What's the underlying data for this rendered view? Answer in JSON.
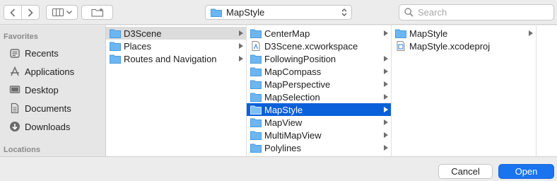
{
  "toolbar": {
    "path_label": "MapStyle",
    "search_placeholder": "Search"
  },
  "sidebar": {
    "favorites_header": "Favorites",
    "locations_header": "Locations",
    "items": [
      {
        "label": "Recents",
        "icon": "recents-icon"
      },
      {
        "label": "Applications",
        "icon": "applications-icon"
      },
      {
        "label": "Desktop",
        "icon": "desktop-icon"
      },
      {
        "label": "Documents",
        "icon": "documents-icon"
      },
      {
        "label": "Downloads",
        "icon": "downloads-icon"
      }
    ]
  },
  "columns": [
    {
      "items": [
        {
          "label": "D3Scene",
          "type": "folder",
          "selected": "gray"
        },
        {
          "label": "Places",
          "type": "folder"
        },
        {
          "label": "Routes and Navigation",
          "type": "folder"
        }
      ]
    },
    {
      "items": [
        {
          "label": "CenterMap",
          "type": "folder"
        },
        {
          "label": "D3Scene.xcworkspace",
          "type": "file"
        },
        {
          "label": "FollowingPosition",
          "type": "folder"
        },
        {
          "label": "MapCompass",
          "type": "folder"
        },
        {
          "label": "MapPerspective",
          "type": "folder"
        },
        {
          "label": "MapSelection",
          "type": "folder"
        },
        {
          "label": "MapStyle",
          "type": "folder",
          "selected": "blue"
        },
        {
          "label": "MapView",
          "type": "folder"
        },
        {
          "label": "MultiMapView",
          "type": "folder"
        },
        {
          "label": "Polylines",
          "type": "folder"
        }
      ]
    },
    {
      "items": [
        {
          "label": "MapStyle",
          "type": "folder"
        },
        {
          "label": "MapStyle.xcodeproj",
          "type": "file"
        }
      ]
    }
  ],
  "footer": {
    "cancel_label": "Cancel",
    "open_label": "Open"
  },
  "colors": {
    "selection_blue": "#0a60d9",
    "selection_gray": "#dcdcdc",
    "folder_blue": "#6cb6f2",
    "primary_button": "#1a74f0"
  }
}
